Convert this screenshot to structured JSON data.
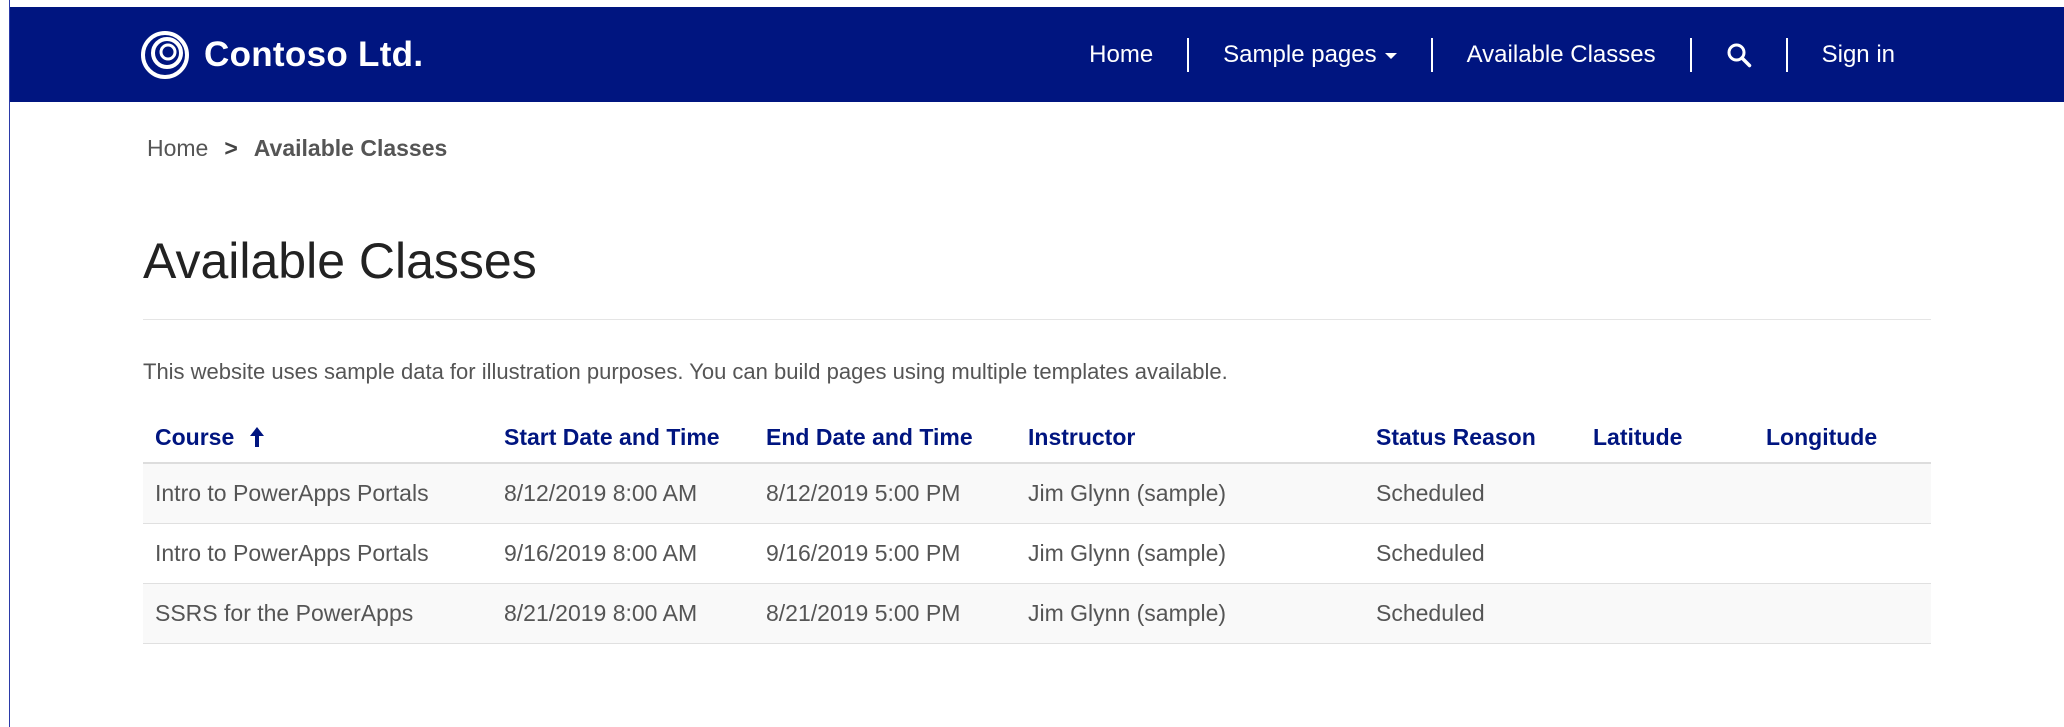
{
  "header": {
    "brand": "Contoso Ltd.",
    "nav": {
      "home": "Home",
      "sample_pages": "Sample pages",
      "available_classes": "Available Classes",
      "sign_in": "Sign in"
    },
    "bg_color": "#001580"
  },
  "breadcrumb": {
    "home": "Home",
    "separator": ">",
    "current": "Available Classes"
  },
  "page": {
    "title": "Available Classes",
    "intro": "This website uses sample data for illustration purposes. You can build pages using multiple templates available."
  },
  "table": {
    "columns": [
      "Course",
      "Start Date and Time",
      "End Date and Time",
      "Instructor",
      "Status Reason",
      "Latitude",
      "Longitude"
    ],
    "sort_column": "Course",
    "sort_direction": "ascending",
    "rows": [
      [
        "Intro to PowerApps Portals",
        "8/12/2019 8:00 AM",
        "8/12/2019 5:00 PM",
        "Jim Glynn (sample)",
        "Scheduled",
        "",
        ""
      ],
      [
        "Intro to PowerApps Portals",
        "9/16/2019 8:00 AM",
        "9/16/2019 5:00 PM",
        "Jim Glynn (sample)",
        "Scheduled",
        "",
        ""
      ],
      [
        "SSRS for the PowerApps",
        "8/21/2019 8:00 AM",
        "8/21/2019 5:00 PM",
        "Jim Glynn (sample)",
        "Scheduled",
        "",
        ""
      ]
    ]
  },
  "icons": {
    "logo": "contoso-logo-icon",
    "dropdown": "caret-down-icon",
    "search": "search-icon",
    "sort": "arrow-up-icon"
  }
}
